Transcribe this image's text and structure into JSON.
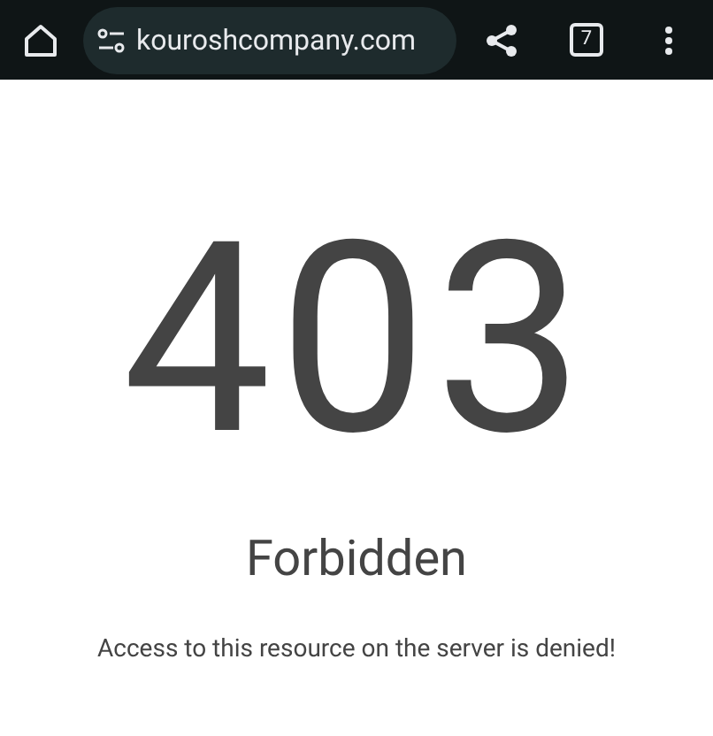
{
  "browser_bar": {
    "url": "kouroshcompany.com",
    "tab_count": "7"
  },
  "page": {
    "code": "403",
    "title": "Forbidden",
    "message": "Access to this resource on the server is denied!"
  }
}
